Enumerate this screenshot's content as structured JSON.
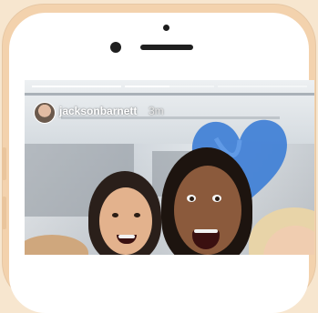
{
  "story": {
    "username": "jacksonbarnett",
    "time_ago": "3m",
    "progress": [
      1.0,
      0.5,
      0.0
    ],
    "heart_color": "#3f7fd6"
  },
  "icons": {
    "avatar": "profile-avatar",
    "heart": "heart-sticker"
  }
}
